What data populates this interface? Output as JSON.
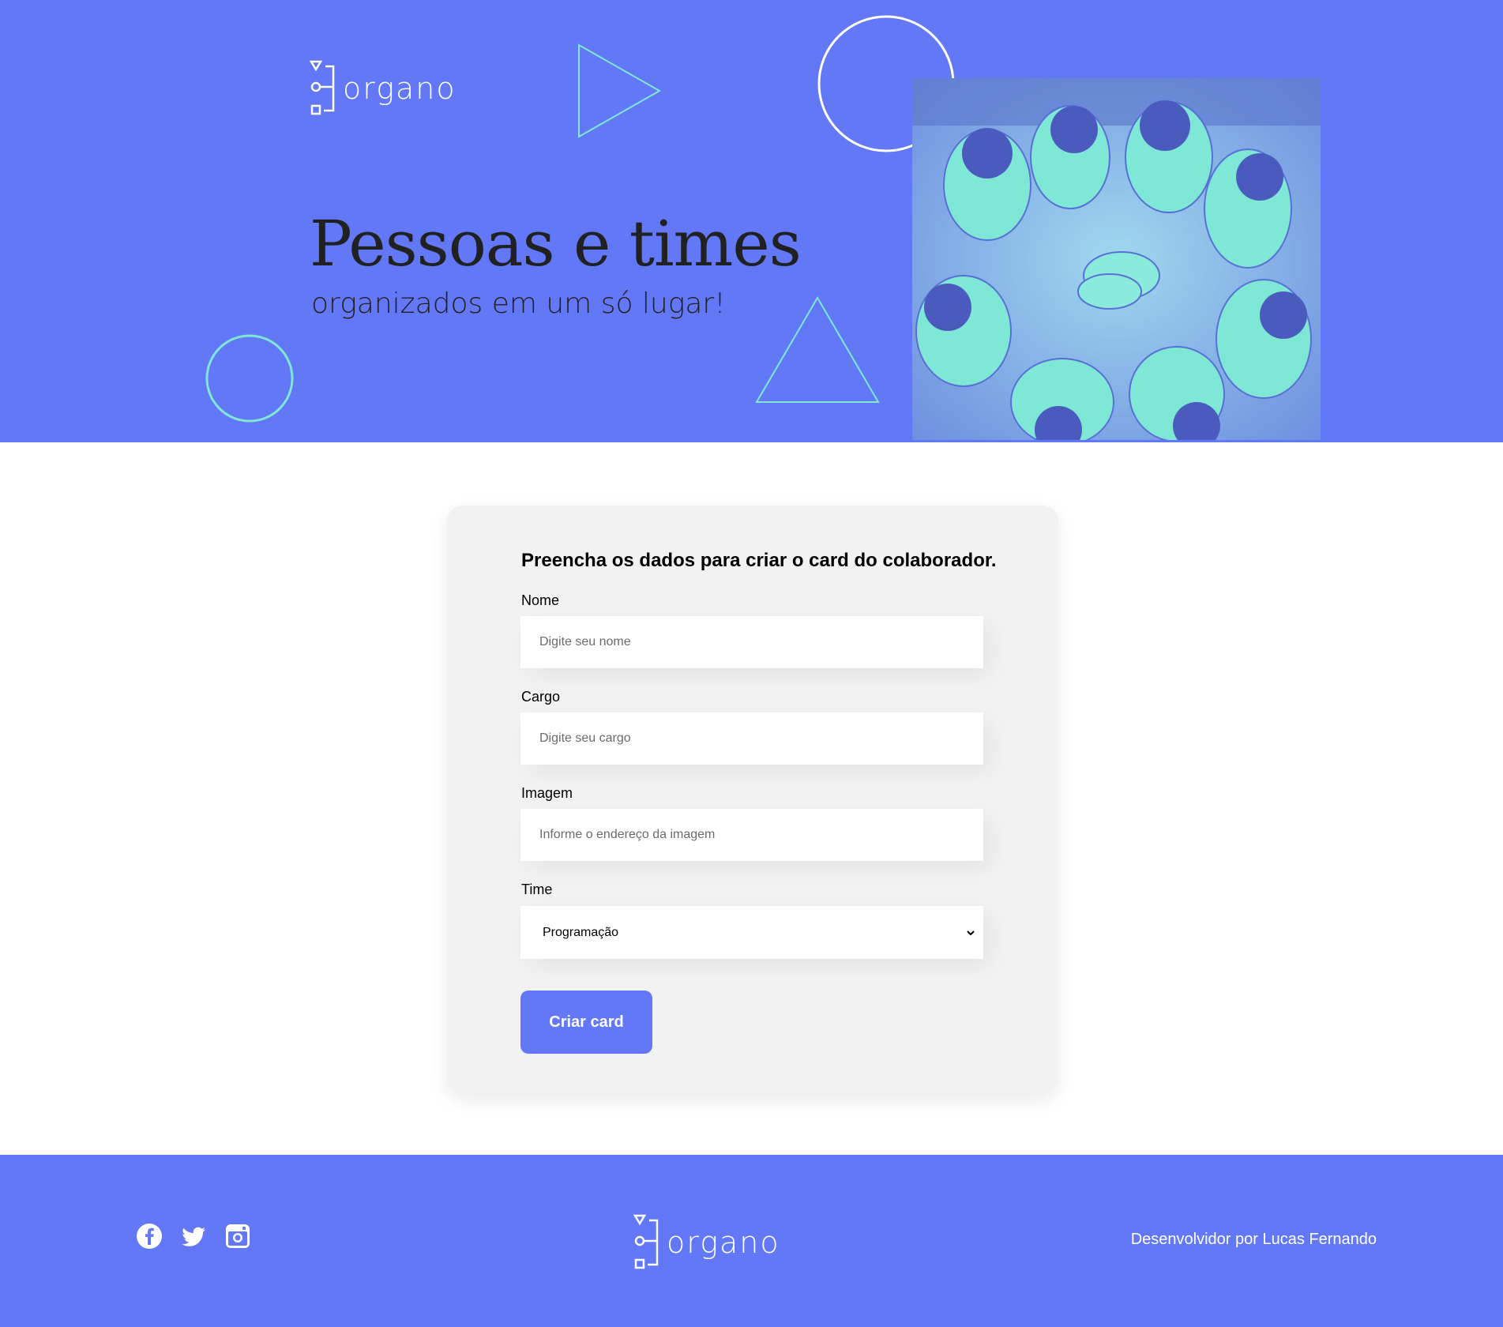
{
  "colors": {
    "brand": "#6278f7",
    "accent": "#7ee7d6",
    "text_dark": "#212121",
    "card_bg": "#f2f2f2"
  },
  "header": {
    "logo_text": "organo",
    "title": "Pessoas e times",
    "subtitle": "organizados em um só lugar!",
    "photo": "team-hands-together-photo"
  },
  "form": {
    "title": "Preencha os dados para criar o card do colaborador.",
    "fields": [
      {
        "label": "Nome",
        "placeholder": "Digite seu nome",
        "value": ""
      },
      {
        "label": "Cargo",
        "placeholder": "Digite seu cargo",
        "value": ""
      },
      {
        "label": "Imagem",
        "placeholder": "Informe o endereço da imagem",
        "value": ""
      }
    ],
    "team": {
      "label": "Time",
      "selected": "Programação",
      "icon": "chevron-down-icon"
    },
    "submit_label": "Criar card"
  },
  "footer": {
    "social": [
      {
        "name": "facebook-icon"
      },
      {
        "name": "twitter-icon"
      },
      {
        "name": "instagram-icon"
      }
    ],
    "logo_text": "organo",
    "credit": "Desenvolvidor por Lucas Fernando"
  }
}
